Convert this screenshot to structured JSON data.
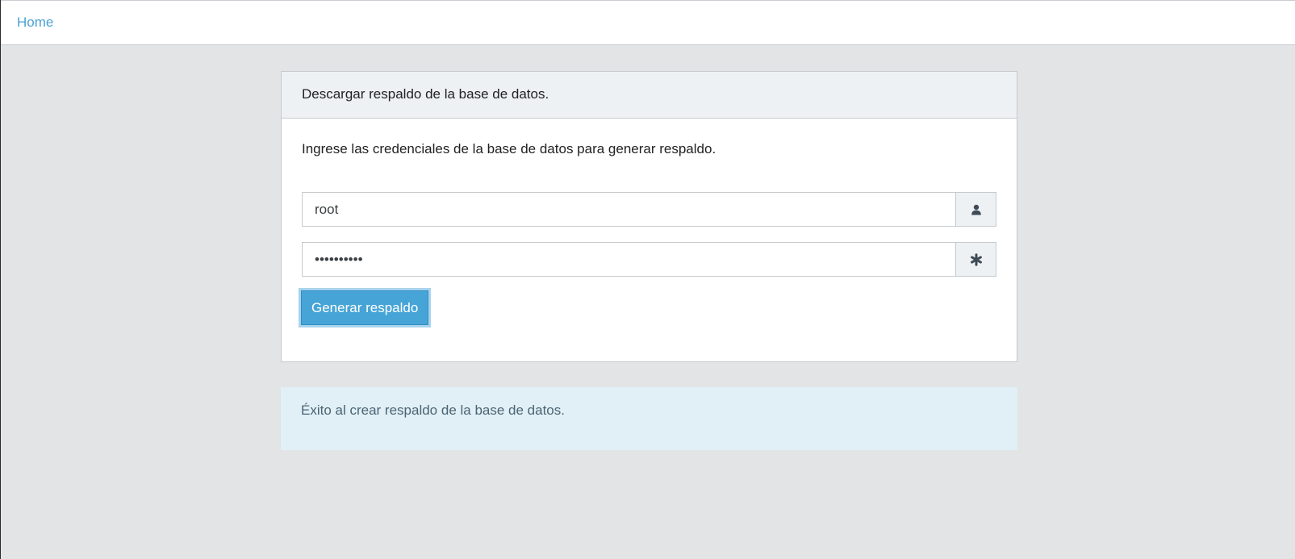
{
  "nav": {
    "home_label": "Home"
  },
  "panel": {
    "heading": "Descargar respaldo de la base de datos.",
    "intro": "Ingrese las credenciales de la base de datos para generar respaldo.",
    "username": {
      "value": "root",
      "icon": "user-icon"
    },
    "password": {
      "value": "••••••••••",
      "icon": "asterisk-icon"
    },
    "submit_label": "Generar respaldo"
  },
  "alert": {
    "message": "Éxito al crear respaldo de la base de datos."
  },
  "colors": {
    "link": "#4aa3d4",
    "button": "#47a4d6",
    "alert_bg": "#e1f0f6",
    "page_bg": "#e2e4e6"
  }
}
